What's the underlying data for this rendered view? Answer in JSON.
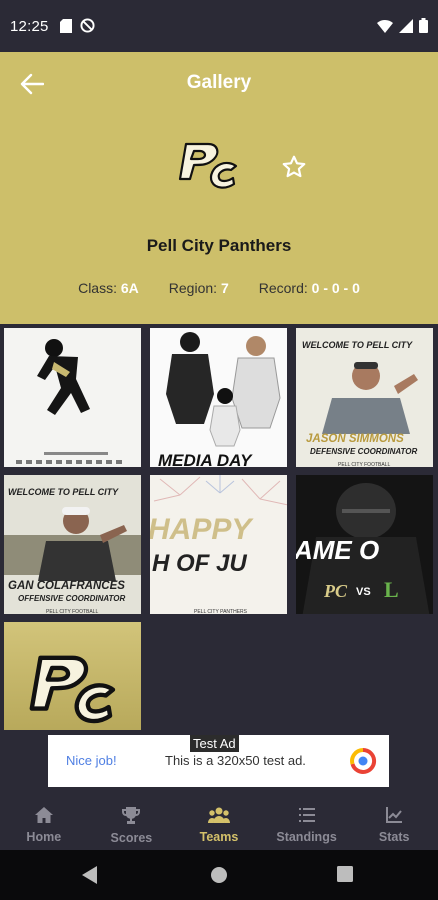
{
  "status_bar": {
    "time": "12:25"
  },
  "header": {
    "title": "Gallery",
    "team_name": "Pell City Panthers",
    "class_label": "Class:",
    "class_value": "6A",
    "region_label": "Region:",
    "region_value": "7",
    "record_label": "Record:",
    "record_value": "0 - 0 - 0"
  },
  "gallery": {
    "tiles": [
      {
        "caption": ""
      },
      {
        "caption": "MEDIA DAY"
      },
      {
        "caption": "JASON SIMMONS",
        "sub": "DEFENSIVE COORDINATOR",
        "top": "WELCOME TO PELL CITY",
        "foot": "PELL CITY FOOTBALL"
      },
      {
        "caption": "GAN COLAFRANCES",
        "sub": "OFFENSIVE COORDINATOR",
        "top": "WELCOME TO PELL CITY",
        "foot": "PELL CITY FOOTBALL"
      },
      {
        "caption": "HAPPY",
        "sub": "H OF JU",
        "foot": "PELL CITY PANTHERS"
      },
      {
        "caption": "AME O",
        "vs": "VS"
      }
    ]
  },
  "ad": {
    "tag": "Test Ad",
    "nice": "Nice job!",
    "text": "This is a 320x50 test ad."
  },
  "bottom_nav": {
    "items": [
      {
        "label": "Home",
        "icon": "home-icon"
      },
      {
        "label": "Scores",
        "icon": "trophy-icon"
      },
      {
        "label": "Teams",
        "icon": "team-icon"
      },
      {
        "label": "Standings",
        "icon": "list-icon"
      },
      {
        "label": "Stats",
        "icon": "chart-icon"
      }
    ],
    "active": "Teams"
  },
  "colors": {
    "accent": "#cdbf6a",
    "dark": "#2b2a36",
    "nav_active": "#d4c16a"
  }
}
